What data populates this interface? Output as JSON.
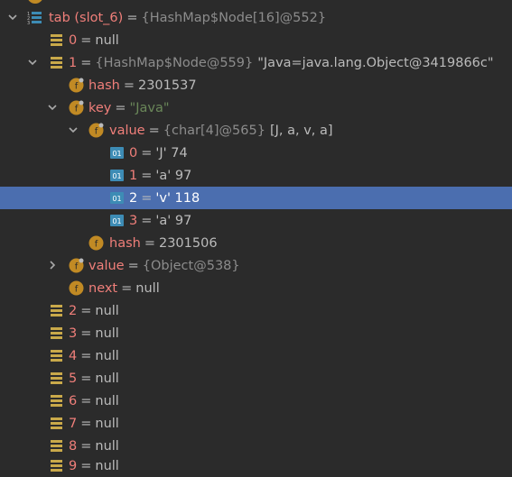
{
  "tree": {
    "rows": [
      {
        "label": "tab (slot_6)",
        "value": "{HashMap$Node[16]@552}"
      },
      {
        "label": "0",
        "value": "null"
      },
      {
        "label": "1",
        "ref": "{HashMap$Node@559}",
        "desc": "\"Java=java.lang.Object@3419866c\""
      },
      {
        "label": "hash",
        "value": "2301537"
      },
      {
        "label": "key",
        "str": "\"Java\""
      },
      {
        "label": "value",
        "ref": "{char[4]@565}",
        "desc": "[J, a, v, a]"
      },
      {
        "label": "0",
        "value": "'J' 74"
      },
      {
        "label": "1",
        "value": "'a' 97"
      },
      {
        "label": "2",
        "value": "'v' 118"
      },
      {
        "label": "3",
        "value": "'a' 97"
      },
      {
        "label": "hash",
        "value": "2301506"
      },
      {
        "label": "value",
        "ref": "{Object@538}"
      },
      {
        "label": "next",
        "value": "null"
      },
      {
        "label": "2",
        "value": "null"
      },
      {
        "label": "3",
        "value": "null"
      },
      {
        "label": "4",
        "value": "null"
      },
      {
        "label": "5",
        "value": "null"
      },
      {
        "label": "6",
        "value": "null"
      },
      {
        "label": "7",
        "value": "null"
      },
      {
        "label": "8",
        "value": "null"
      },
      {
        "label": "9",
        "value": "null"
      }
    ]
  },
  "colors": {
    "background": "#2b2b2b",
    "selection": "#4b6eaf",
    "field_name": "#f07f7a",
    "string": "#6a8759",
    "reference": "#8c8c8c",
    "field_icon": "#c18a24",
    "array_icon": "#c9a94a",
    "primitive_icon": "#3d8cb5"
  },
  "icons": {
    "array": "array-elements-icon",
    "field": "field-f-icon",
    "primitive": "primitive-01-icon",
    "array_slot": "array-stack-icon"
  }
}
